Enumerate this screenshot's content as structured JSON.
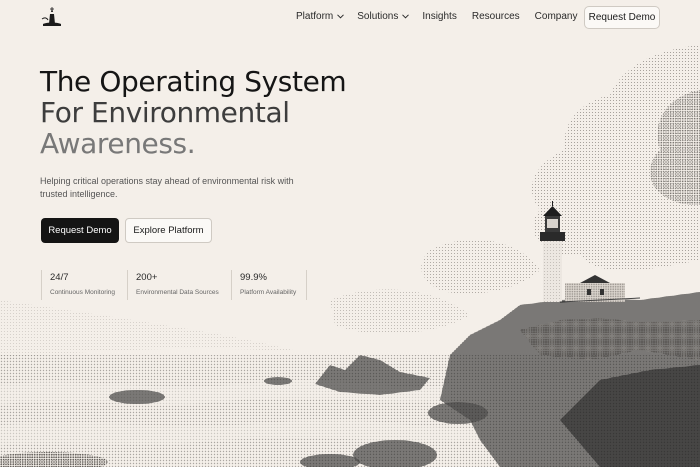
{
  "nav": {
    "logo_icon": "lighthouse-logo-icon",
    "items": [
      {
        "label": "Platform",
        "has_dropdown": true
      },
      {
        "label": "Solutions",
        "has_dropdown": true
      },
      {
        "label": "Insights",
        "has_dropdown": false
      },
      {
        "label": "Resources",
        "has_dropdown": false
      },
      {
        "label": "Company",
        "has_dropdown": false
      }
    ],
    "cta_label": "Request Demo"
  },
  "hero": {
    "title_line1": "The Operating System",
    "title_line2": "For Environmental",
    "title_line3": "Awareness.",
    "subtitle": "Helping critical operations stay ahead of environmental risk with trusted intelligence.",
    "primary_cta": "Request Demo",
    "secondary_cta": "Explore Platform"
  },
  "stats": [
    {
      "value": "24/7",
      "label": "Continuous Monitoring"
    },
    {
      "value": "200+",
      "label": "Environmental Data Sources"
    },
    {
      "value": "99.9%",
      "label": "Platform Availability"
    }
  ],
  "colors": {
    "background": "#f4efe9",
    "text": "#1b1b1b",
    "primary_button": "#141414"
  }
}
